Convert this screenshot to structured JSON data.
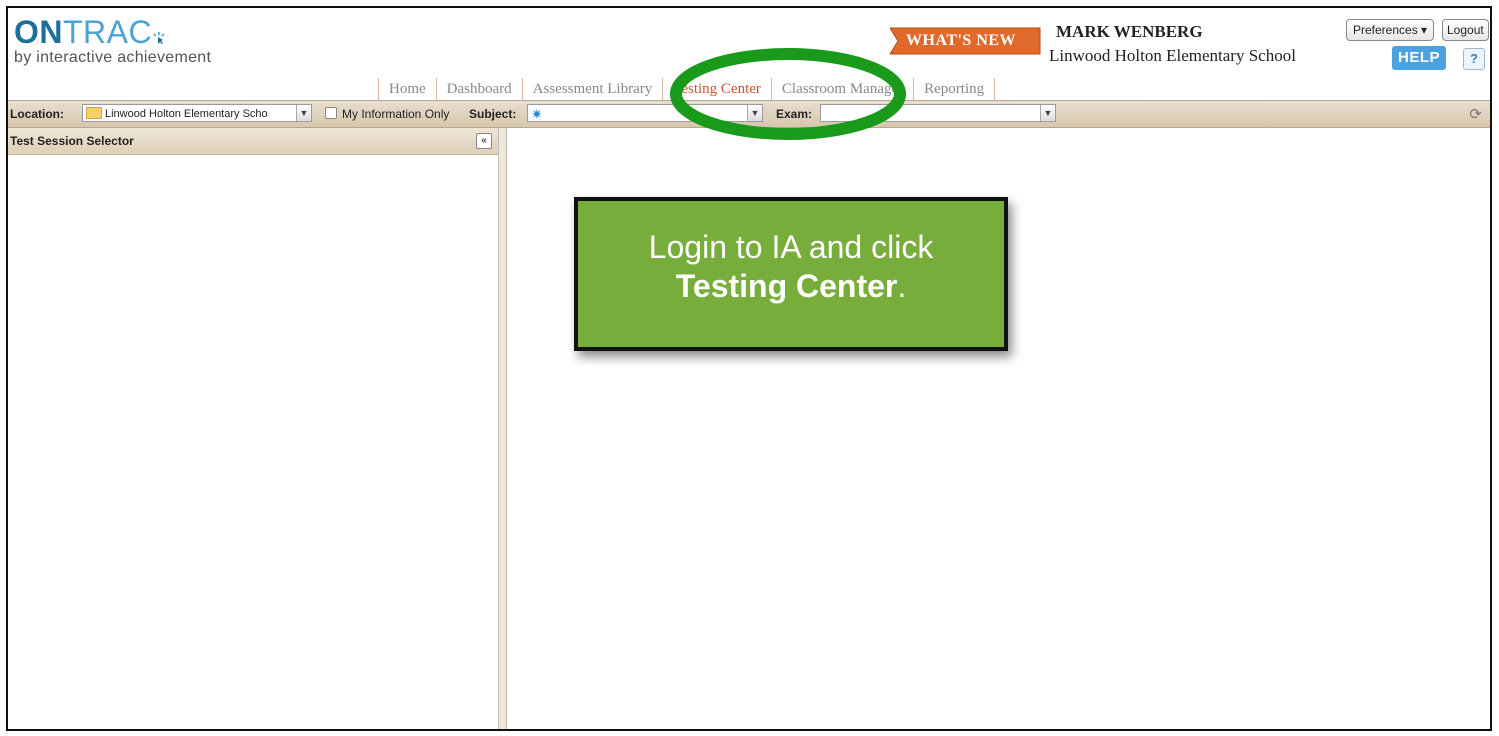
{
  "brand": {
    "logo_on": "ON",
    "logo_trac": "TRAC",
    "tagline": "by interactive achievement"
  },
  "header": {
    "whats_new": "WHAT'S NEW",
    "user_name": "MARK WENBERG",
    "school": "Linwood Holton Elementary School",
    "preferences_label": "Preferences",
    "logout_label": "Logout",
    "help_label": "HELP",
    "question_label": "?"
  },
  "nav": {
    "items": [
      "Home",
      "Dashboard",
      "Assessment Library",
      "Testing Center",
      "Classroom Manager",
      "Reporting"
    ],
    "active": "Testing Center"
  },
  "toolbar": {
    "location_label": "Location:",
    "location_value": "Linwood Holton Elementary Scho",
    "my_info_label": "My Information Only",
    "subject_label": "Subject:",
    "subject_value": "",
    "exam_label": "Exam:",
    "exam_value": ""
  },
  "left_panel": {
    "title": "Test Session Selector",
    "collapse_label": "«"
  },
  "callout": {
    "line1": "Login to IA and click",
    "line2_bold": "Testing Center",
    "line2_tail": "."
  },
  "colors": {
    "accent": "#d0512a",
    "brand_blue": "#2a86b8",
    "callout_green": "#77ad3b",
    "ellipse_green": "#1a9a1a",
    "toolbar_tan": "#ddd0b8"
  },
  "icons": {
    "logo_spark": "spark-icon",
    "folder": "folder-icon",
    "subject_star": "asterisk-icon",
    "refresh": "refresh-icon"
  }
}
